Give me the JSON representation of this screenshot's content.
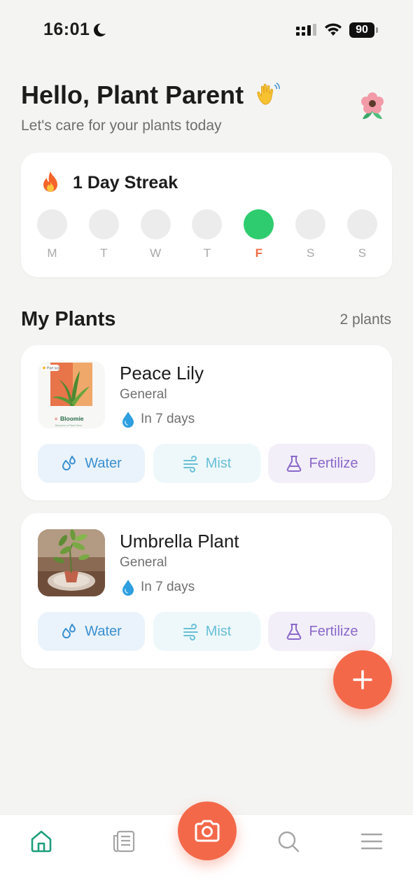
{
  "status_bar": {
    "time": "16:01",
    "battery": "90",
    "icons": [
      "moon-icon",
      "signal-icon",
      "wifi-icon",
      "battery-icon"
    ]
  },
  "header": {
    "greeting": "Hello, Plant Parent",
    "greeting_icon": "waving-hand-icon",
    "subtitle": "Let's care for your plants today",
    "avatar_icon": "flower-icon"
  },
  "streak": {
    "icon": "fire-icon",
    "title": "1 Day Streak",
    "days": [
      {
        "label": "M",
        "done": false
      },
      {
        "label": "T",
        "done": false
      },
      {
        "label": "W",
        "done": false
      },
      {
        "label": "T",
        "done": false
      },
      {
        "label": "F",
        "done": true
      },
      {
        "label": "S",
        "done": false
      },
      {
        "label": "S",
        "done": false
      }
    ]
  },
  "plants_section": {
    "title": "My Plants",
    "count": "2 plants",
    "plants": [
      {
        "name": "Peace Lily",
        "category": "General",
        "next_watering": "In 7 days",
        "thumb_text": "Bloomie",
        "thumb_badge": "Part sun",
        "thumb_caption": "Become a Plant Hero",
        "actions": {
          "water": "Water",
          "mist": "Mist",
          "fertilize": "Fertilize"
        }
      },
      {
        "name": "Umbrella Plant",
        "category": "General",
        "next_watering": "In 7 days",
        "actions": {
          "water": "Water",
          "mist": "Mist",
          "fertilize": "Fertilize"
        }
      }
    ]
  },
  "fab": {
    "icon": "plus-icon"
  },
  "bottom_nav": {
    "items": [
      "home-icon",
      "journal-icon",
      "camera-icon",
      "search-icon",
      "menu-icon"
    ],
    "active": "home-icon"
  },
  "colors": {
    "accent": "#f4684a",
    "streak_active": "#2ecc6e",
    "water": "#3a8fcf",
    "mist": "#69bfd8",
    "fertilize": "#8b68c9",
    "nav_active": "#1f9e7c"
  }
}
